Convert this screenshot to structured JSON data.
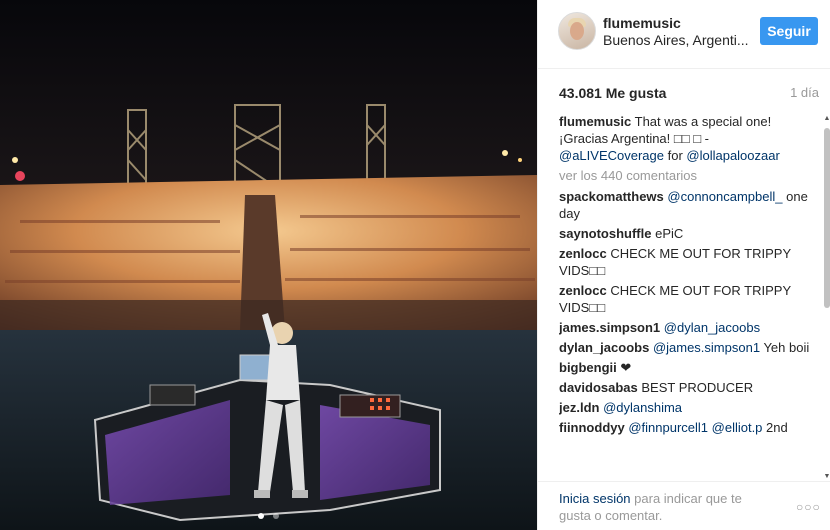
{
  "post": {
    "carousel_dots": 2,
    "active_dot": 0
  },
  "header": {
    "username": "flumemusic",
    "location": "Buenos Aires, Argenti...",
    "follow_label": "Seguir"
  },
  "stats": {
    "likes": "43.081 Me gusta",
    "time": "1 día"
  },
  "caption": {
    "user": "flumemusic",
    "text_1": "That was a special one! ¡Gracias Argentina! □□",
    "text_2": "□ - ",
    "mention_1": "@aLIVECoverage",
    "text_3": " for ",
    "mention_2": "@lollapaloozaar"
  },
  "view_more": "ver los 440 comentarios",
  "comments": [
    {
      "user": "spackomatthews",
      "mention": "@connoncampbell_",
      "text": "one day"
    },
    {
      "user": "saynotoshuffle",
      "mention": "",
      "text": "ePiC"
    },
    {
      "user": "zenlocc",
      "mention": "",
      "text": "CHECK ME OUT FOR TRIPPY VIDS□□"
    },
    {
      "user": "zenlocc",
      "mention": "",
      "text": "CHECK ME OUT FOR TRIPPY VIDS□□"
    },
    {
      "user": "james.simpson1",
      "mention": "@dylan_jacoobs",
      "text": ""
    },
    {
      "user": "dylan_jacoobs",
      "mention": "@james.simpson1",
      "text": "Yeh boii"
    },
    {
      "user": "bigbengii",
      "mention": "",
      "text": "❤"
    },
    {
      "user": "davidosabas",
      "mention": "",
      "text": "BEST PRODUCER"
    },
    {
      "user": "jez.ldn",
      "mention": "@dylanshima",
      "text": ""
    },
    {
      "user": "fiinnoddyy",
      "mention": "@finnpurcell1 @elliot.p",
      "text": "2nd"
    }
  ],
  "footer": {
    "login": "Inicia sesión",
    "rest": " para indicar que te gusta o comentar.",
    "more": "○○○"
  }
}
